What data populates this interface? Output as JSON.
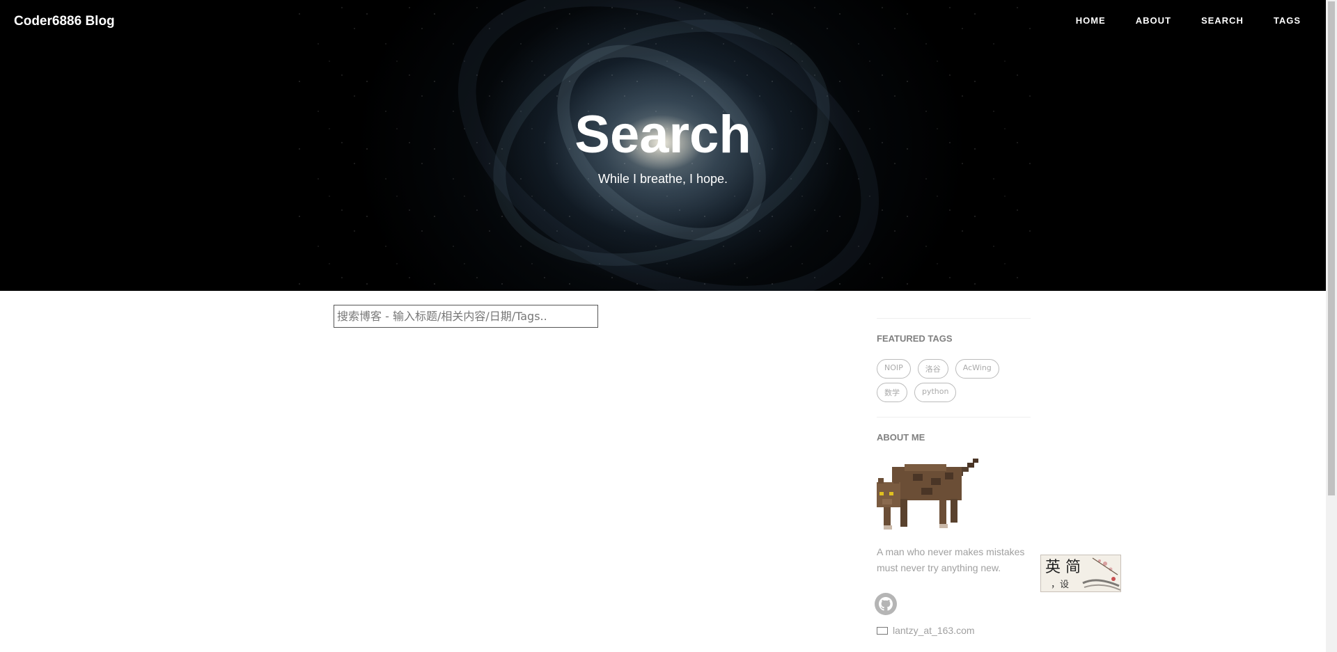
{
  "site": {
    "title": "Coder6886 Blog"
  },
  "nav": [
    {
      "label": "HOME"
    },
    {
      "label": "ABOUT"
    },
    {
      "label": "SEARCH"
    },
    {
      "label": "TAGS"
    }
  ],
  "hero": {
    "title": "Search",
    "subtitle": "While I breathe, I hope."
  },
  "search": {
    "placeholder": "搜索博客 - 输入标题/相关内容/日期/Tags..",
    "value": ""
  },
  "sidebar": {
    "featured_tags_title": "FEATURED TAGS",
    "tags": [
      "NOIP",
      "洛谷",
      "AcWing",
      "数学",
      "python"
    ],
    "about_title": "ABOUT ME",
    "description": "A man who never makes mistakes must never try anything new.",
    "email": "lantzy_at_163.com"
  },
  "stamp": {
    "text_main": "英 简",
    "text_sub": "，设"
  },
  "icons": [
    "github-icon",
    "mail-icon"
  ],
  "colors": {
    "hero_bg": "#000000",
    "tag_text": "#aaaaaa",
    "muted_text": "#a0a0a0"
  }
}
